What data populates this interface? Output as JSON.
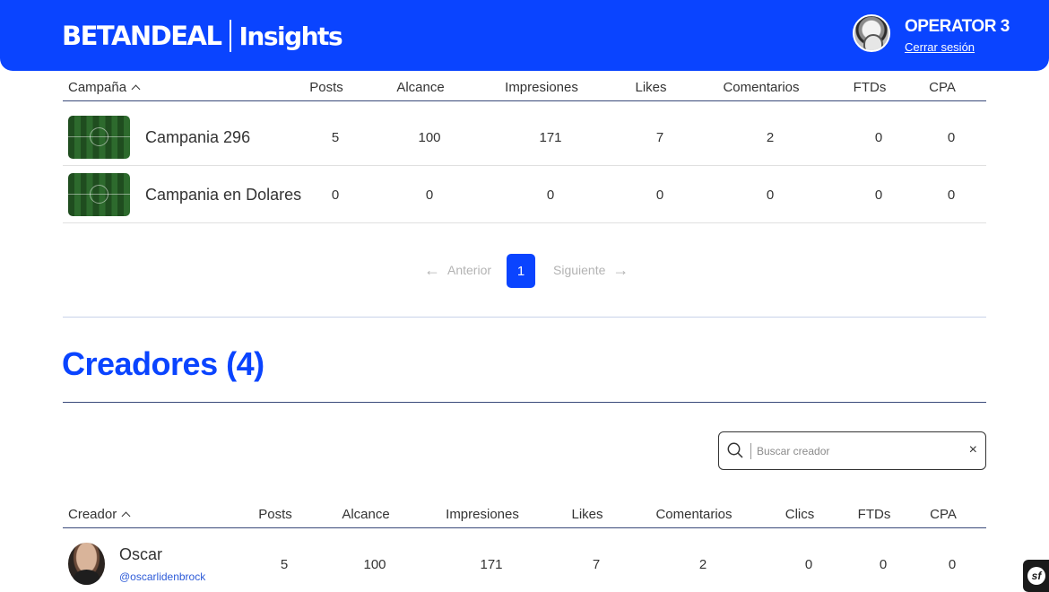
{
  "header": {
    "brand": "BETANDEAL",
    "subtitle": "Insights",
    "operator_name": "OPERATOR 3",
    "logout_label": "Cerrar sesión"
  },
  "campaigns_table": {
    "columns": [
      "Campaña",
      "Posts",
      "Alcance",
      "Impresiones",
      "Likes",
      "Comentarios",
      "FTDs",
      "CPA"
    ],
    "rows": [
      {
        "name": "Campania 296",
        "posts": "5",
        "alcance": "100",
        "impresiones": "171",
        "likes": "7",
        "comentarios": "2",
        "ftds": "0",
        "cpa": "0"
      },
      {
        "name": "Campania en Dolares",
        "posts": "0",
        "alcance": "0",
        "impresiones": "0",
        "likes": "0",
        "comentarios": "0",
        "ftds": "0",
        "cpa": "0"
      }
    ]
  },
  "pagination": {
    "prev_label": "Anterior",
    "current_page": "1",
    "next_label": "Siguiente"
  },
  "creators_section": {
    "title": "Creadores (4)",
    "search_placeholder": "Buscar creador",
    "columns": [
      "Creador",
      "Posts",
      "Alcance",
      "Impresiones",
      "Likes",
      "Comentarios",
      "Clics",
      "FTDs",
      "CPA"
    ],
    "rows": [
      {
        "name": "Oscar",
        "handle": "@oscarlidenbrock",
        "posts": "5",
        "alcance": "100",
        "impresiones": "171",
        "likes": "7",
        "comentarios": "2",
        "clics": "0",
        "ftds": "0",
        "cpa": "0"
      }
    ]
  },
  "colors": {
    "brand_blue": "#0a44ff",
    "link_blue": "#2d5bd8",
    "muted_gray": "#b3b3b3"
  },
  "icons": [
    "arrow-left-icon",
    "arrow-right-icon",
    "search-icon",
    "close-icon",
    "sort-chevron-up-icon",
    "symfony-icon"
  ]
}
